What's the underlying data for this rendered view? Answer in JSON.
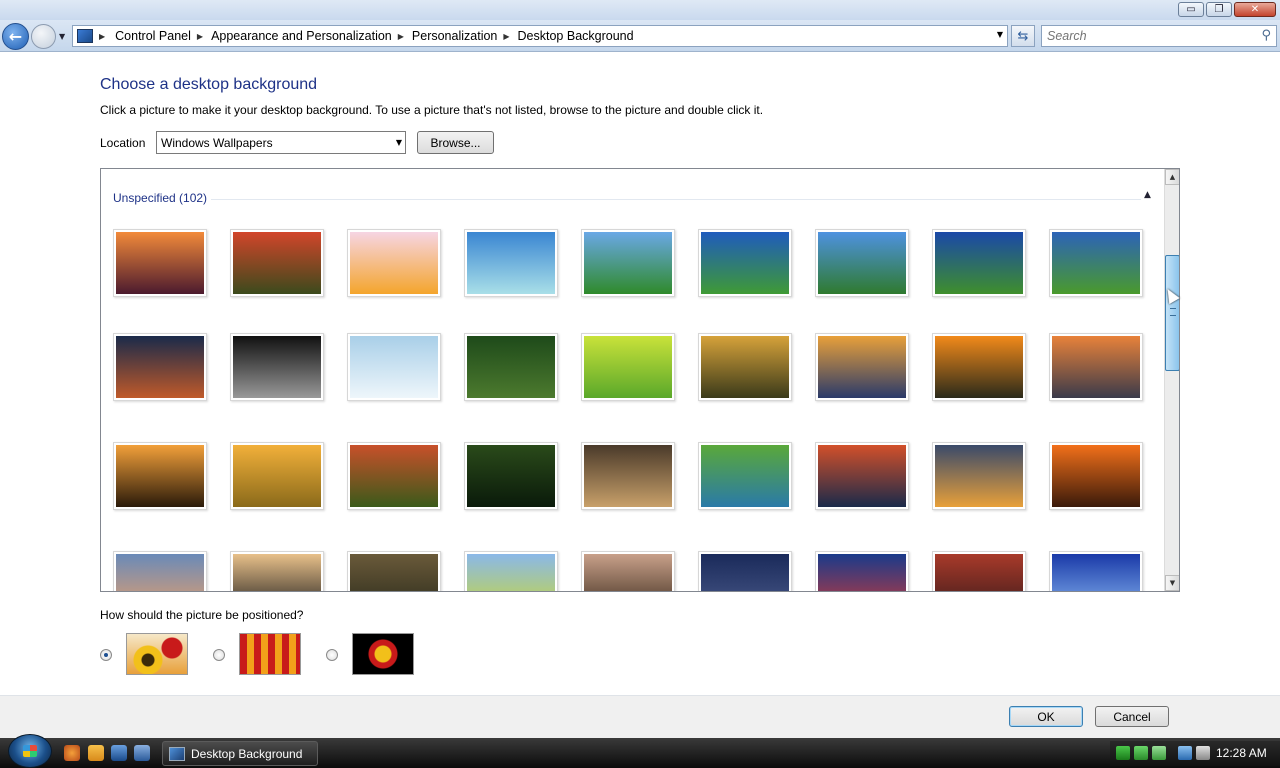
{
  "window": {
    "controls": {
      "minimize": "▭",
      "maximize": "❐",
      "close": "✕"
    }
  },
  "address_bar": {
    "crumbs": [
      "Control Panel",
      "Appearance and Personalization",
      "Personalization",
      "Desktop Background"
    ],
    "search_placeholder": "Search"
  },
  "content": {
    "heading": "Choose a desktop background",
    "subtitle": "Click a picture to make it your desktop background. To use a picture that's not listed, browse to the picture and double click it.",
    "location_label": "Location",
    "location_value": "Windows Wallpapers",
    "browse_label": "Browse...",
    "group_label": "Unspecified (102)"
  },
  "wallpapers": [
    {
      "name": "sunset-grass",
      "colors": [
        "#f28a3a",
        "#4b1a2e"
      ]
    },
    {
      "name": "red-tulips",
      "colors": [
        "#d2452a",
        "#3b4a1c"
      ]
    },
    {
      "name": "orange-flower",
      "colors": [
        "#f6d5e3",
        "#f4a52c"
      ]
    },
    {
      "name": "tropical-island",
      "colors": [
        "#3a86d2",
        "#a9dfe8"
      ]
    },
    {
      "name": "green-hills",
      "colors": [
        "#6aa8e6",
        "#2f8a2a"
      ]
    },
    {
      "name": "blue-sky-meadow",
      "colors": [
        "#1f5bbd",
        "#3f9a35"
      ]
    },
    {
      "name": "clear-sky-field",
      "colors": [
        "#4e92e0",
        "#2f7a2e"
      ]
    },
    {
      "name": "cloud-plains",
      "colors": [
        "#1a48a8",
        "#3f8f2c"
      ]
    },
    {
      "name": "rolling-hill",
      "colors": [
        "#2c63b8",
        "#4a9a2c"
      ]
    },
    {
      "name": "dusk-horizon",
      "colors": [
        "#1a2a4a",
        "#c05a2a"
      ]
    },
    {
      "name": "city-night",
      "colors": [
        "#111111",
        "#999999"
      ]
    },
    {
      "name": "soft-clouds",
      "colors": [
        "#a9cfe8",
        "#eef6fb"
      ]
    },
    {
      "name": "green-leaves",
      "colors": [
        "#1e4a1a",
        "#4c7a2e"
      ]
    },
    {
      "name": "lime-leaf",
      "colors": [
        "#c9e23a",
        "#5aa82a"
      ]
    },
    {
      "name": "lone-tree",
      "colors": [
        "#d6a23a",
        "#3a3a1a"
      ]
    },
    {
      "name": "river-sunset",
      "colors": [
        "#e8a03a",
        "#2a3a6a"
      ]
    },
    {
      "name": "fiery-lake",
      "colors": [
        "#f28a1a",
        "#2a2a1a"
      ]
    },
    {
      "name": "beach-sunset",
      "colors": [
        "#e8823a",
        "#3a3a4a"
      ]
    },
    {
      "name": "swamp-sunset",
      "colors": [
        "#f2a03a",
        "#2a1a0a"
      ]
    },
    {
      "name": "wheat-field",
      "colors": [
        "#f2b03a",
        "#8a6a1a"
      ]
    },
    {
      "name": "river-valley",
      "colors": [
        "#c8502a",
        "#3a5a1a"
      ]
    },
    {
      "name": "forest-waterfall",
      "colors": [
        "#2a4a1a",
        "#0a1a0a"
      ]
    },
    {
      "name": "moon-tree",
      "colors": [
        "#4a3a2a",
        "#c8a06a"
      ]
    },
    {
      "name": "green-tree-field",
      "colors": [
        "#5aa83a",
        "#2a7aa8"
      ]
    },
    {
      "name": "ocean-sunset",
      "colors": [
        "#d2502a",
        "#1a2a4a"
      ]
    },
    {
      "name": "pier-sunset",
      "colors": [
        "#3a4a6a",
        "#e8a03a"
      ]
    },
    {
      "name": "orange-sky-island",
      "colors": [
        "#f2701a",
        "#3a1a0a"
      ]
    },
    {
      "name": "cloudy-dusk",
      "colors": [
        "#6a8ab8",
        "#e8a06a"
      ]
    },
    {
      "name": "silhouette-trees",
      "colors": [
        "#e8c08a",
        "#1a1a1a"
      ]
    },
    {
      "name": "stormy-field",
      "colors": [
        "#6a5a3a",
        "#2a2a1a"
      ]
    },
    {
      "name": "yellow-meadow",
      "colors": [
        "#8ab8e8",
        "#c8d83a"
      ]
    },
    {
      "name": "wooden-house",
      "colors": [
        "#c8a08a",
        "#3a2a1a"
      ]
    },
    {
      "name": "night-bridge",
      "colors": [
        "#1a2a5a",
        "#4a5a8a"
      ]
    },
    {
      "name": "lit-buildings",
      "colors": [
        "#1a3a8a",
        "#c83a3a"
      ]
    },
    {
      "name": "red-cityscape",
      "colors": [
        "#a83a2a",
        "#3a1a1a"
      ]
    },
    {
      "name": "blue-cloudscape",
      "colors": [
        "#1a3aa8",
        "#8ab8f2"
      ]
    }
  ],
  "positioning": {
    "label": "How should the picture be positioned?",
    "options": [
      {
        "name": "fill",
        "selected": true
      },
      {
        "name": "tile",
        "selected": false
      },
      {
        "name": "center",
        "selected": false
      }
    ]
  },
  "footer": {
    "ok_label": "OK",
    "cancel_label": "Cancel"
  },
  "taskbar": {
    "task_title": "Desktop Background",
    "clock": "12:28 AM"
  }
}
